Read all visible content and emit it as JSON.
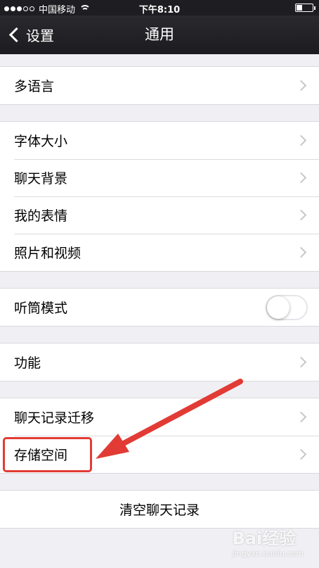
{
  "status_bar": {
    "carrier": "中国移动",
    "time": "下午8:10"
  },
  "nav": {
    "back_label": "设置",
    "title": "通用"
  },
  "groups": {
    "g1": [
      "多语言"
    ],
    "g2": [
      "字体大小",
      "聊天背景",
      "我的表情",
      "照片和视频"
    ],
    "g3": {
      "label": "听筒模式",
      "toggle_on": false
    },
    "g4": [
      "功能"
    ],
    "g5": [
      "聊天记录迁移",
      "存储空间"
    ],
    "g6": "清空聊天记录"
  },
  "annotation": {
    "color": "#e23b35"
  },
  "watermark": {
    "text": "Bai经验",
    "sub": "jingyan.baidu.com"
  }
}
